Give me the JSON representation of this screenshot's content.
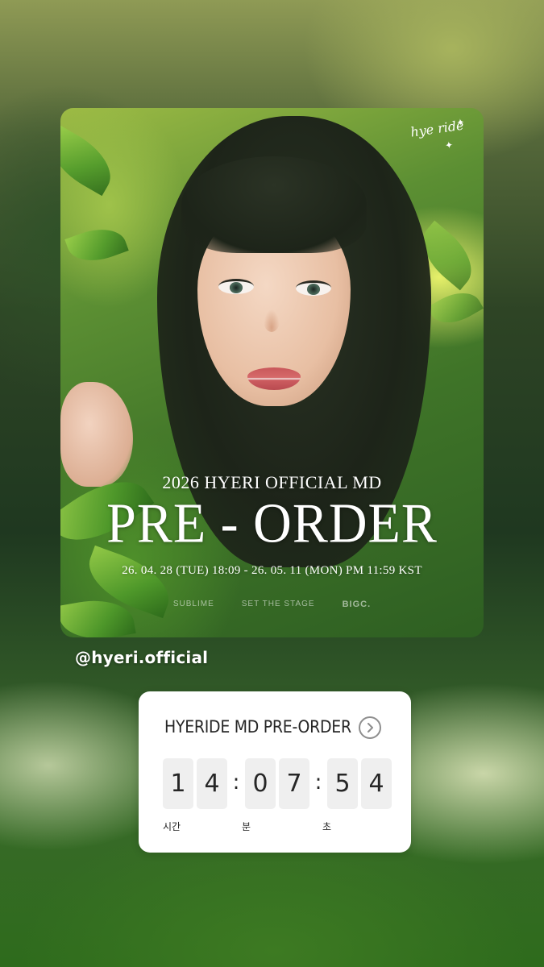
{
  "poster": {
    "logo_text": "hye ride",
    "subtitle": "2026 HYERI OFFICIAL MD",
    "headline": "PRE - ORDER",
    "dates": "26. 04. 28 (TUE) 18:09 - 26. 05. 11 (MON) PM 11:59 KST",
    "sponsors": [
      "SUBLIME",
      "SET THE STAGE",
      "BIGC."
    ]
  },
  "mention": {
    "handle": "@hyeri.official"
  },
  "countdown": {
    "title": "HYERIDE MD PRE-ORDER",
    "icon": "chevron-right-icon",
    "digits": [
      "1",
      "4",
      "0",
      "7",
      "5",
      "4"
    ],
    "separator": ":",
    "units": {
      "hours": "시간",
      "minutes": "분",
      "seconds": "초"
    }
  },
  "colors": {
    "card_bg": "#ffffff",
    "digit_bg": "#efefef",
    "text": "#262626"
  }
}
